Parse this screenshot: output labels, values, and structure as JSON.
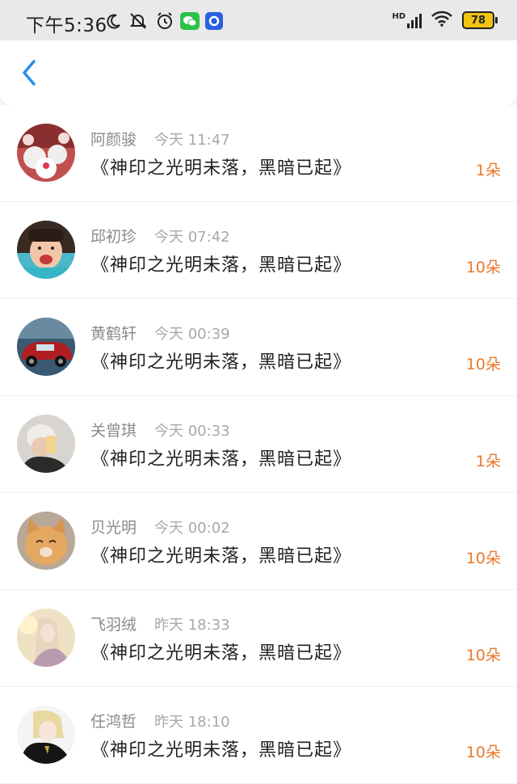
{
  "status_bar": {
    "time": "下午5:36",
    "battery": "78",
    "network": "HD",
    "icons": [
      "moon-icon",
      "mute-bell-icon",
      "alarm-icon",
      "wechat-icon",
      "app-circle-icon",
      "signal-icon",
      "wifi-icon",
      "battery-icon"
    ]
  },
  "header": {
    "back_icon": "chevron-left-icon",
    "accent": "#2a8ee8"
  },
  "colors": {
    "amount": "#e8782a",
    "name": "#8a8a8a"
  },
  "items": [
    {
      "name": "阿颜骏",
      "time": "今天 11:47",
      "title": "《神印之光明未落，黑暗已起》",
      "amount": "1朵"
    },
    {
      "name": "邱初珍",
      "time": "今天 07:42",
      "title": "《神印之光明未落，黑暗已起》",
      "amount": "10朵"
    },
    {
      "name": "黄鹤轩",
      "time": "今天 00:39",
      "title": "《神印之光明未落，黑暗已起》",
      "amount": "10朵"
    },
    {
      "name": "关曾琪",
      "time": "今天 00:33",
      "title": "《神印之光明未落，黑暗已起》",
      "amount": "1朵"
    },
    {
      "name": "贝光明",
      "time": "今天 00:02",
      "title": "《神印之光明未落，黑暗已起》",
      "amount": "10朵"
    },
    {
      "name": "飞羽绒",
      "time": "昨天 18:33",
      "title": "《神印之光明未落，黑暗已起》",
      "amount": "10朵"
    },
    {
      "name": "任鸿哲",
      "time": "昨天 18:10",
      "title": "《神印之光明未落，黑暗已起》",
      "amount": "10朵"
    }
  ]
}
